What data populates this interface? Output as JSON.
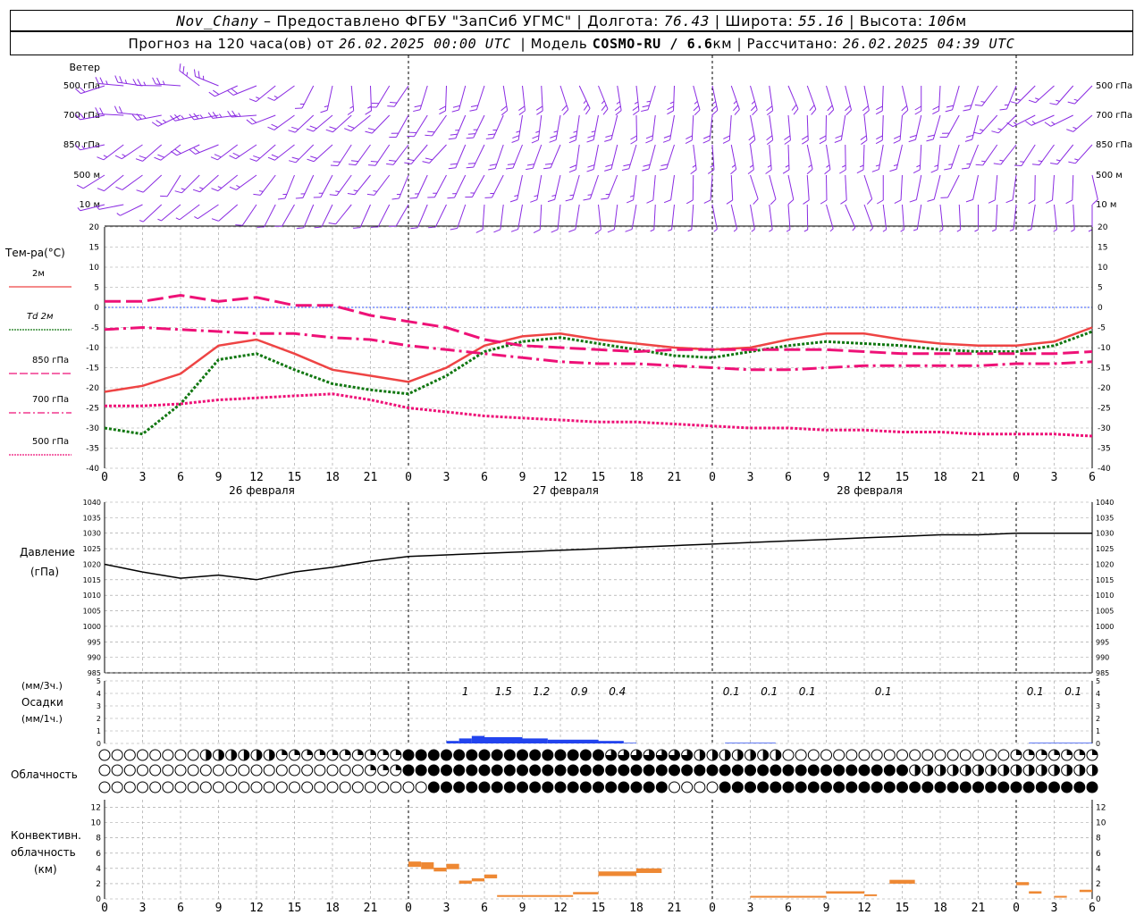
{
  "header": {
    "station": "Nov_Chany",
    "provider": "Предоставлено ФГБУ \"ЗапСиб УГМС\"",
    "longitude_label": "Долгота:",
    "longitude": "76.43",
    "latitude_label": "Широта:",
    "latitude": "55.16",
    "altitude_label": "Высота:",
    "altitude": "106",
    "altitude_unit": "м",
    "forecast_text": "Прогноз на 120 часа(ов) от",
    "forecast_start": "26.02.2025 00:00 UTC",
    "model_label": "Модель",
    "model_name": "COSMO-RU / 6.6",
    "model_unit": "км",
    "computed_label": "Рассчитано:",
    "computed_time": "26.02.2025 04:39 UTC"
  },
  "colors": {
    "wind": "#8a2be2",
    "t2m": "#ee4444",
    "td2m": "#117711",
    "t850": "#ee1177",
    "t700": "#ee1177",
    "t500": "#ee1177",
    "zero_line": "#3355ff",
    "pressure": "#000000",
    "precip": "#2244ee",
    "convective": "#ee8833",
    "grid": "#999999"
  },
  "chart_data": [
    {
      "type": "wind_barbs",
      "row_label": "Ветер",
      "levels": [
        "500 гПа",
        "700 гПа",
        "850 гПа",
        "500 м",
        "10 м"
      ],
      "x_hours_range": [
        0,
        126
      ]
    },
    {
      "type": "line",
      "ylabel": "Тем-ра(°C)",
      "ylim": [
        -40,
        20
      ],
      "yticks": [
        20,
        15,
        10,
        5,
        0,
        -5,
        -10,
        -15,
        -20,
        -25,
        -30,
        -35,
        -40
      ],
      "xticks": [
        "0",
        "3",
        "6",
        "9",
        "12",
        "15",
        "18",
        "21",
        "0",
        "3",
        "6",
        "9",
        "12",
        "15",
        "18",
        "21",
        "0",
        "3",
        "6",
        "9",
        "12",
        "15",
        "18",
        "21",
        "0",
        "3",
        "6"
      ],
      "day_labels": [
        "26 февраля",
        "27 февраля",
        "28 февраля"
      ],
      "x": [
        0,
        3,
        6,
        9,
        12,
        15,
        18,
        21,
        24,
        27,
        30,
        33,
        36,
        39,
        42,
        45,
        48,
        51,
        54,
        57,
        60,
        63,
        66,
        69,
        72,
        75,
        78
      ],
      "series": [
        {
          "name": "2м",
          "style": "solid",
          "values": [
            -21,
            -19.5,
            -16.5,
            -9.5,
            -8,
            -11.5,
            -15.5,
            -17,
            -18.5,
            -15,
            -9.5,
            -7.2,
            -6.5,
            -8,
            -9,
            -10,
            -10.5,
            -10,
            -8,
            -6.5,
            -6.5,
            -8,
            -9,
            -9.5,
            -9.5,
            -8.5,
            -5
          ]
        },
        {
          "name": "Td 2м",
          "style": "dashed",
          "values": [
            -30,
            -31.5,
            -24,
            -13,
            -11.5,
            -15.5,
            -19,
            -20.5,
            -21.5,
            -17,
            -11,
            -8.5,
            -7.5,
            -9,
            -10.5,
            -12,
            -12.5,
            -11,
            -9.5,
            -8.5,
            -9,
            -9.5,
            -10.5,
            -11,
            -11,
            -9.5,
            -6
          ]
        },
        {
          "name": "850 гПа",
          "style": "longdash",
          "values": [
            1.5,
            1.5,
            3,
            1.5,
            2.5,
            0.5,
            0.5,
            -2,
            -3.5,
            -5,
            -8,
            -9.5,
            -10,
            -10.5,
            -11,
            -10.5,
            -10.5,
            -10.5,
            -10.5,
            -10.5,
            -11,
            -11.5,
            -11.5,
            -11.5,
            -11.5,
            -11.5,
            -11
          ]
        },
        {
          "name": "700 гПа",
          "style": "dashdot",
          "values": [
            -5.5,
            -5,
            -5.5,
            -6,
            -6.5,
            -6.5,
            -7.5,
            -8,
            -9.5,
            -10.5,
            -11.5,
            -12.5,
            -13.5,
            -14,
            -14,
            -14.5,
            -15,
            -15.5,
            -15.5,
            -15,
            -14.5,
            -14.5,
            -14.5,
            -14.5,
            -14,
            -14,
            -13.5
          ]
        },
        {
          "name": "500 гПа",
          "style": "dotted",
          "values": [
            -24.5,
            -24.5,
            -24,
            -23,
            -22.5,
            -22,
            -21.5,
            -23,
            -25,
            -26,
            -27,
            -27.5,
            -28,
            -28.5,
            -28.5,
            -29,
            -29.5,
            -30,
            -30,
            -30.5,
            -30.5,
            -31,
            -31,
            -31.5,
            -31.5,
            -31.5,
            -32
          ]
        }
      ]
    },
    {
      "type": "line",
      "ylabel": "Давление",
      "yunit": "(гПа)",
      "ylim": [
        985,
        1040
      ],
      "yticks": [
        1040,
        1035,
        1030,
        1025,
        1020,
        1015,
        1010,
        1005,
        1000,
        995,
        990,
        985
      ],
      "x": [
        0,
        3,
        6,
        9,
        12,
        15,
        18,
        21,
        24,
        27,
        30,
        33,
        36,
        39,
        42,
        45,
        48,
        51,
        54,
        57,
        60,
        63,
        66,
        69,
        72,
        75,
        78
      ],
      "values": [
        1020,
        1017.5,
        1015.5,
        1016.5,
        1015,
        1017.5,
        1019,
        1021,
        1022.5,
        1023,
        1023.5,
        1024,
        1024.5,
        1025,
        1025.5,
        1026,
        1026.5,
        1027,
        1027.5,
        1028,
        1028.5,
        1029,
        1029.5,
        1029.5,
        1030,
        1030,
        1030
      ]
    },
    {
      "type": "bar",
      "ylabel_top": "(мм/3ч.)",
      "ylabel": "Осадки",
      "yunit": "(мм/1ч.)",
      "ylim": [
        0,
        5
      ],
      "yticks": [
        5,
        4,
        3,
        2,
        1,
        0
      ],
      "amount_labels": [
        {
          "hour": 28.5,
          "text": "1"
        },
        {
          "hour": 31.5,
          "text": "1.5"
        },
        {
          "hour": 34.5,
          "text": "1.2"
        },
        {
          "hour": 37.5,
          "text": "0.9"
        },
        {
          "hour": 40.5,
          "text": "0.4"
        },
        {
          "hour": 49.5,
          "text": "0.1"
        },
        {
          "hour": 52.5,
          "text": "0.1"
        },
        {
          "hour": 55.5,
          "text": "0.1"
        },
        {
          "hour": 61.5,
          "text": "0.1"
        },
        {
          "hour": 73.5,
          "text": "0.1"
        },
        {
          "hour": 76.5,
          "text": "0.1"
        }
      ],
      "hourly_values": [
        {
          "from": 27,
          "to": 28,
          "value": 0.2
        },
        {
          "from": 28,
          "to": 29,
          "value": 0.4
        },
        {
          "from": 29,
          "to": 30,
          "value": 0.6
        },
        {
          "from": 30,
          "to": 33,
          "value": 0.5
        },
        {
          "from": 33,
          "to": 35,
          "value": 0.4
        },
        {
          "from": 35,
          "to": 39,
          "value": 0.3
        },
        {
          "from": 39,
          "to": 41,
          "value": 0.2
        },
        {
          "from": 41,
          "to": 42,
          "value": 0.05
        },
        {
          "from": 49,
          "to": 53,
          "value": 0.05
        },
        {
          "from": 73,
          "to": 78,
          "value": 0.05
        }
      ]
    },
    {
      "type": "symbols",
      "ylabel": "Облачность",
      "layers": [
        "upper",
        "middle",
        "lower"
      ],
      "note": "cloud fraction circles every hour, 0=clear, 1=overcast",
      "upper_segments": [
        [
          0,
          8,
          0
        ],
        [
          8,
          14,
          0.5
        ],
        [
          14,
          24,
          0.25
        ],
        [
          24,
          40,
          1
        ],
        [
          40,
          47,
          0.75
        ],
        [
          47,
          54,
          0.5
        ],
        [
          54,
          72,
          0
        ],
        [
          72,
          79,
          0.25
        ]
      ],
      "middle_segments": [
        [
          0,
          21,
          0
        ],
        [
          21,
          24,
          0.25
        ],
        [
          24,
          64,
          1
        ],
        [
          64,
          70,
          0.5
        ],
        [
          70,
          79,
          0.5
        ]
      ],
      "lower_segments": [
        [
          0,
          26,
          0
        ],
        [
          26,
          45,
          1
        ],
        [
          45,
          49,
          0
        ],
        [
          49,
          79,
          1
        ]
      ]
    },
    {
      "type": "bar",
      "ylabel": "Конвективн.",
      "ylabel2": "облачность",
      "yunit": "(км)",
      "ylim": [
        0,
        13
      ],
      "yticks": [
        12,
        10,
        8,
        6,
        4,
        2,
        0
      ],
      "layers": [
        {
          "from": 24,
          "to": 25,
          "base": 4.2,
          "top": 4.9
        },
        {
          "from": 25,
          "to": 26,
          "base": 3.9,
          "top": 4.8
        },
        {
          "from": 26,
          "to": 27,
          "base": 3.6,
          "top": 4.1
        },
        {
          "from": 27,
          "to": 28,
          "base": 3.9,
          "top": 4.6
        },
        {
          "from": 28,
          "to": 29,
          "base": 2.0,
          "top": 2.4
        },
        {
          "from": 29,
          "to": 30,
          "base": 2.3,
          "top": 2.7
        },
        {
          "from": 30,
          "to": 31,
          "base": 2.7,
          "top": 3.2
        },
        {
          "from": 31,
          "to": 37,
          "base": 0.3,
          "top": 0.5
        },
        {
          "from": 37,
          "to": 39,
          "base": 0.6,
          "top": 0.9
        },
        {
          "from": 39,
          "to": 42,
          "base": 3.0,
          "top": 3.6
        },
        {
          "from": 42,
          "to": 44,
          "base": 3.4,
          "top": 4.0
        },
        {
          "from": 51,
          "to": 57,
          "base": 0.2,
          "top": 0.4
        },
        {
          "from": 57,
          "to": 60,
          "base": 0.7,
          "top": 1.0
        },
        {
          "from": 60,
          "to": 61,
          "base": 0.4,
          "top": 0.6
        },
        {
          "from": 62,
          "to": 64,
          "base": 2.0,
          "top": 2.5
        },
        {
          "from": 72,
          "to": 73,
          "base": 1.8,
          "top": 2.2
        },
        {
          "from": 73,
          "to": 74,
          "base": 0.7,
          "top": 1.0
        },
        {
          "from": 75,
          "to": 76,
          "base": 0.2,
          "top": 0.4
        },
        {
          "from": 77,
          "to": 78,
          "base": 0.9,
          "top": 1.2
        }
      ]
    }
  ]
}
